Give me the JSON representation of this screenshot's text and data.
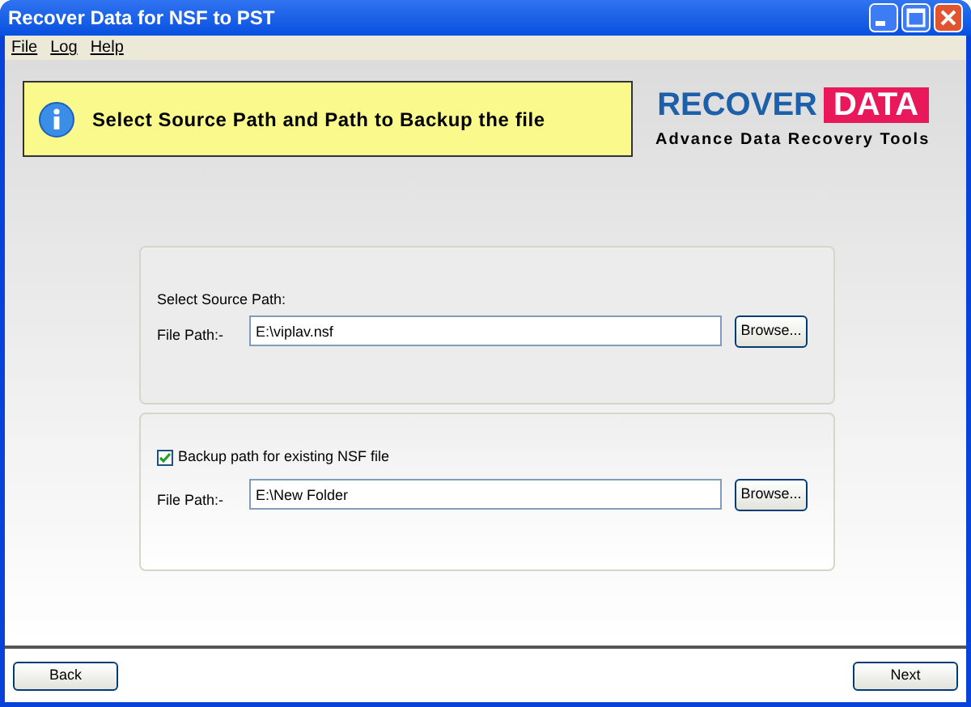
{
  "window": {
    "title": "Recover Data for NSF to PST"
  },
  "menu": [
    "File",
    "Log",
    "Help"
  ],
  "banner": {
    "message": "Select Source Path and Path to Backup the file"
  },
  "logo": {
    "word_1": "RECOVER",
    "word_2": "DATA",
    "tagline": "Advance Data Recovery Tools"
  },
  "source_panel": {
    "heading": "Select Source Path:",
    "label": "File Path:-",
    "value": "E:\\viplav.nsf",
    "button": "Browse..."
  },
  "backup_panel": {
    "checkbox": {
      "label": "Backup path for existing NSF file",
      "checked": true
    },
    "label": "File Path:-",
    "value": "E:\\New Folder",
    "button": "Browse..."
  },
  "footer": {
    "back": "Back",
    "next": "Next"
  }
}
